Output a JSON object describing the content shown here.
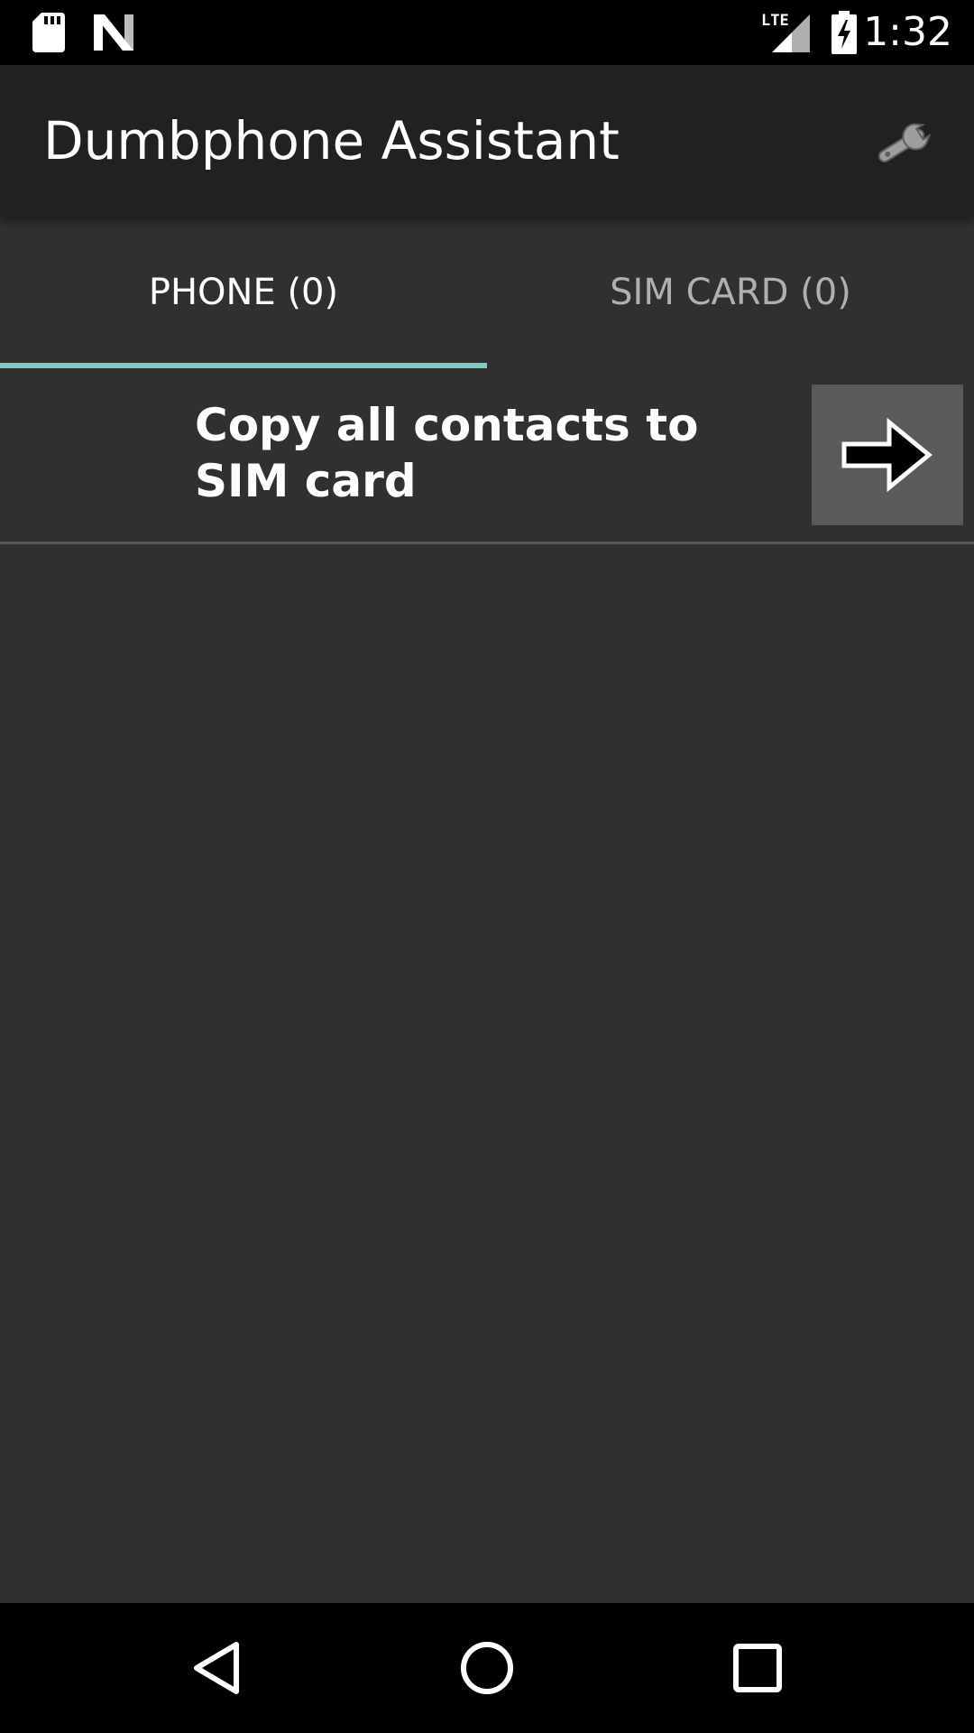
{
  "status_bar": {
    "time": "1:32",
    "network": "LTE",
    "icons": [
      "sd-card-icon",
      "n-logo-icon",
      "lte-signal-icon",
      "battery-charging-icon"
    ]
  },
  "app_bar": {
    "title": "Dumbphone Assistant",
    "settings_icon": "wrench-icon"
  },
  "tabs": [
    {
      "label": "PHONE (0)",
      "active": true
    },
    {
      "label": "SIM CARD (0)",
      "active": false
    }
  ],
  "action": {
    "label": "Copy all contacts to SIM card",
    "button_icon": "arrow-right-icon"
  },
  "nav_bar": {
    "icons": [
      "back-icon",
      "home-icon",
      "recents-icon"
    ]
  },
  "colors": {
    "status_bar": "#000000",
    "app_bar": "#212121",
    "background": "#303030",
    "tab_indicator": "#80cbc4",
    "button_bg": "#5a5a5a"
  }
}
